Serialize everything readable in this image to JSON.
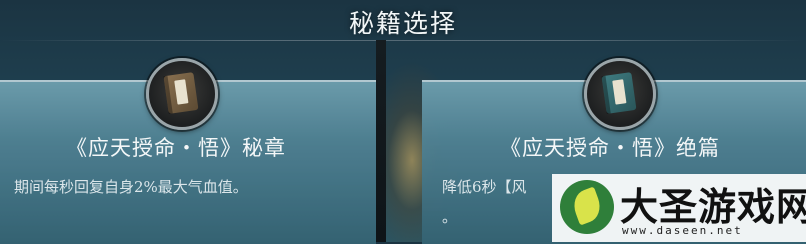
{
  "header": {
    "title": "秘籍选择"
  },
  "cards": [
    {
      "name": "《应天授命・悟》秘章",
      "description": "期间每秒回复自身2%最大气血值。",
      "book_color": "#7a6345"
    },
    {
      "name": "《应天授命・悟》绝篇",
      "description": "降低6秒【风",
      "description_tail": "。",
      "book_color": "#356b70"
    }
  ],
  "watermark": {
    "text": "大圣游戏网",
    "url": "www.daseen.net"
  }
}
